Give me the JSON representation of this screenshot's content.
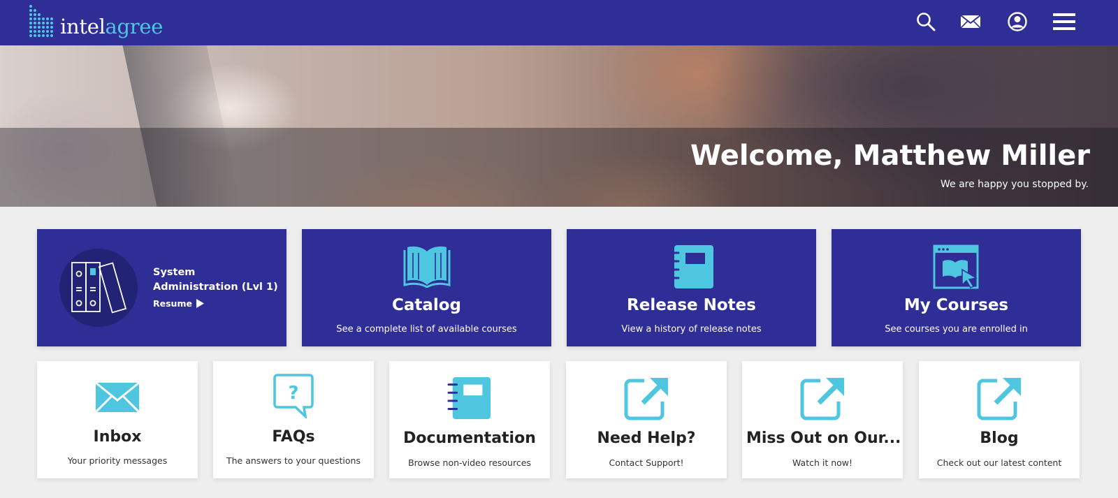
{
  "header": {
    "logo_text_1": "intel",
    "logo_text_2": "agree",
    "brand_color": "#2e2e96",
    "accent_color": "#4fc6e0",
    "icons": [
      "search-icon",
      "mail-icon",
      "user-account-icon",
      "menu-icon"
    ]
  },
  "hero": {
    "title": "Welcome, Matthew Miller",
    "subtitle": "We are happy you stopped by."
  },
  "course_tile": {
    "name": "System Administration (Lvl 1)",
    "resume_label": "Resume",
    "icon": "binders-icon"
  },
  "blue_tiles": [
    {
      "title": "Catalog",
      "subtitle": "See a complete list of available courses",
      "icon": "open-book-icon"
    },
    {
      "title": "Release Notes",
      "subtitle": "View a history of release notes",
      "icon": "notebook-icon"
    },
    {
      "title": "My Courses",
      "subtitle": "See courses you are enrolled in",
      "icon": "browser-course-icon"
    }
  ],
  "white_tiles": [
    {
      "title": "Inbox",
      "subtitle": "Your priority messages",
      "icon": "envelope-icon"
    },
    {
      "title": "FAQs",
      "subtitle": "The answers to your questions",
      "icon": "question-bubble-icon"
    },
    {
      "title": "Documentation",
      "subtitle": "Browse non-video resources",
      "icon": "notebook-icon"
    },
    {
      "title": "Need Help?",
      "subtitle": "Contact Support!",
      "icon": "external-link-icon"
    },
    {
      "title": "Miss Out on Our...",
      "subtitle": "Watch it now!",
      "icon": "external-link-icon"
    },
    {
      "title": "Blog",
      "subtitle": "Check out our latest content",
      "icon": "external-link-icon"
    }
  ]
}
